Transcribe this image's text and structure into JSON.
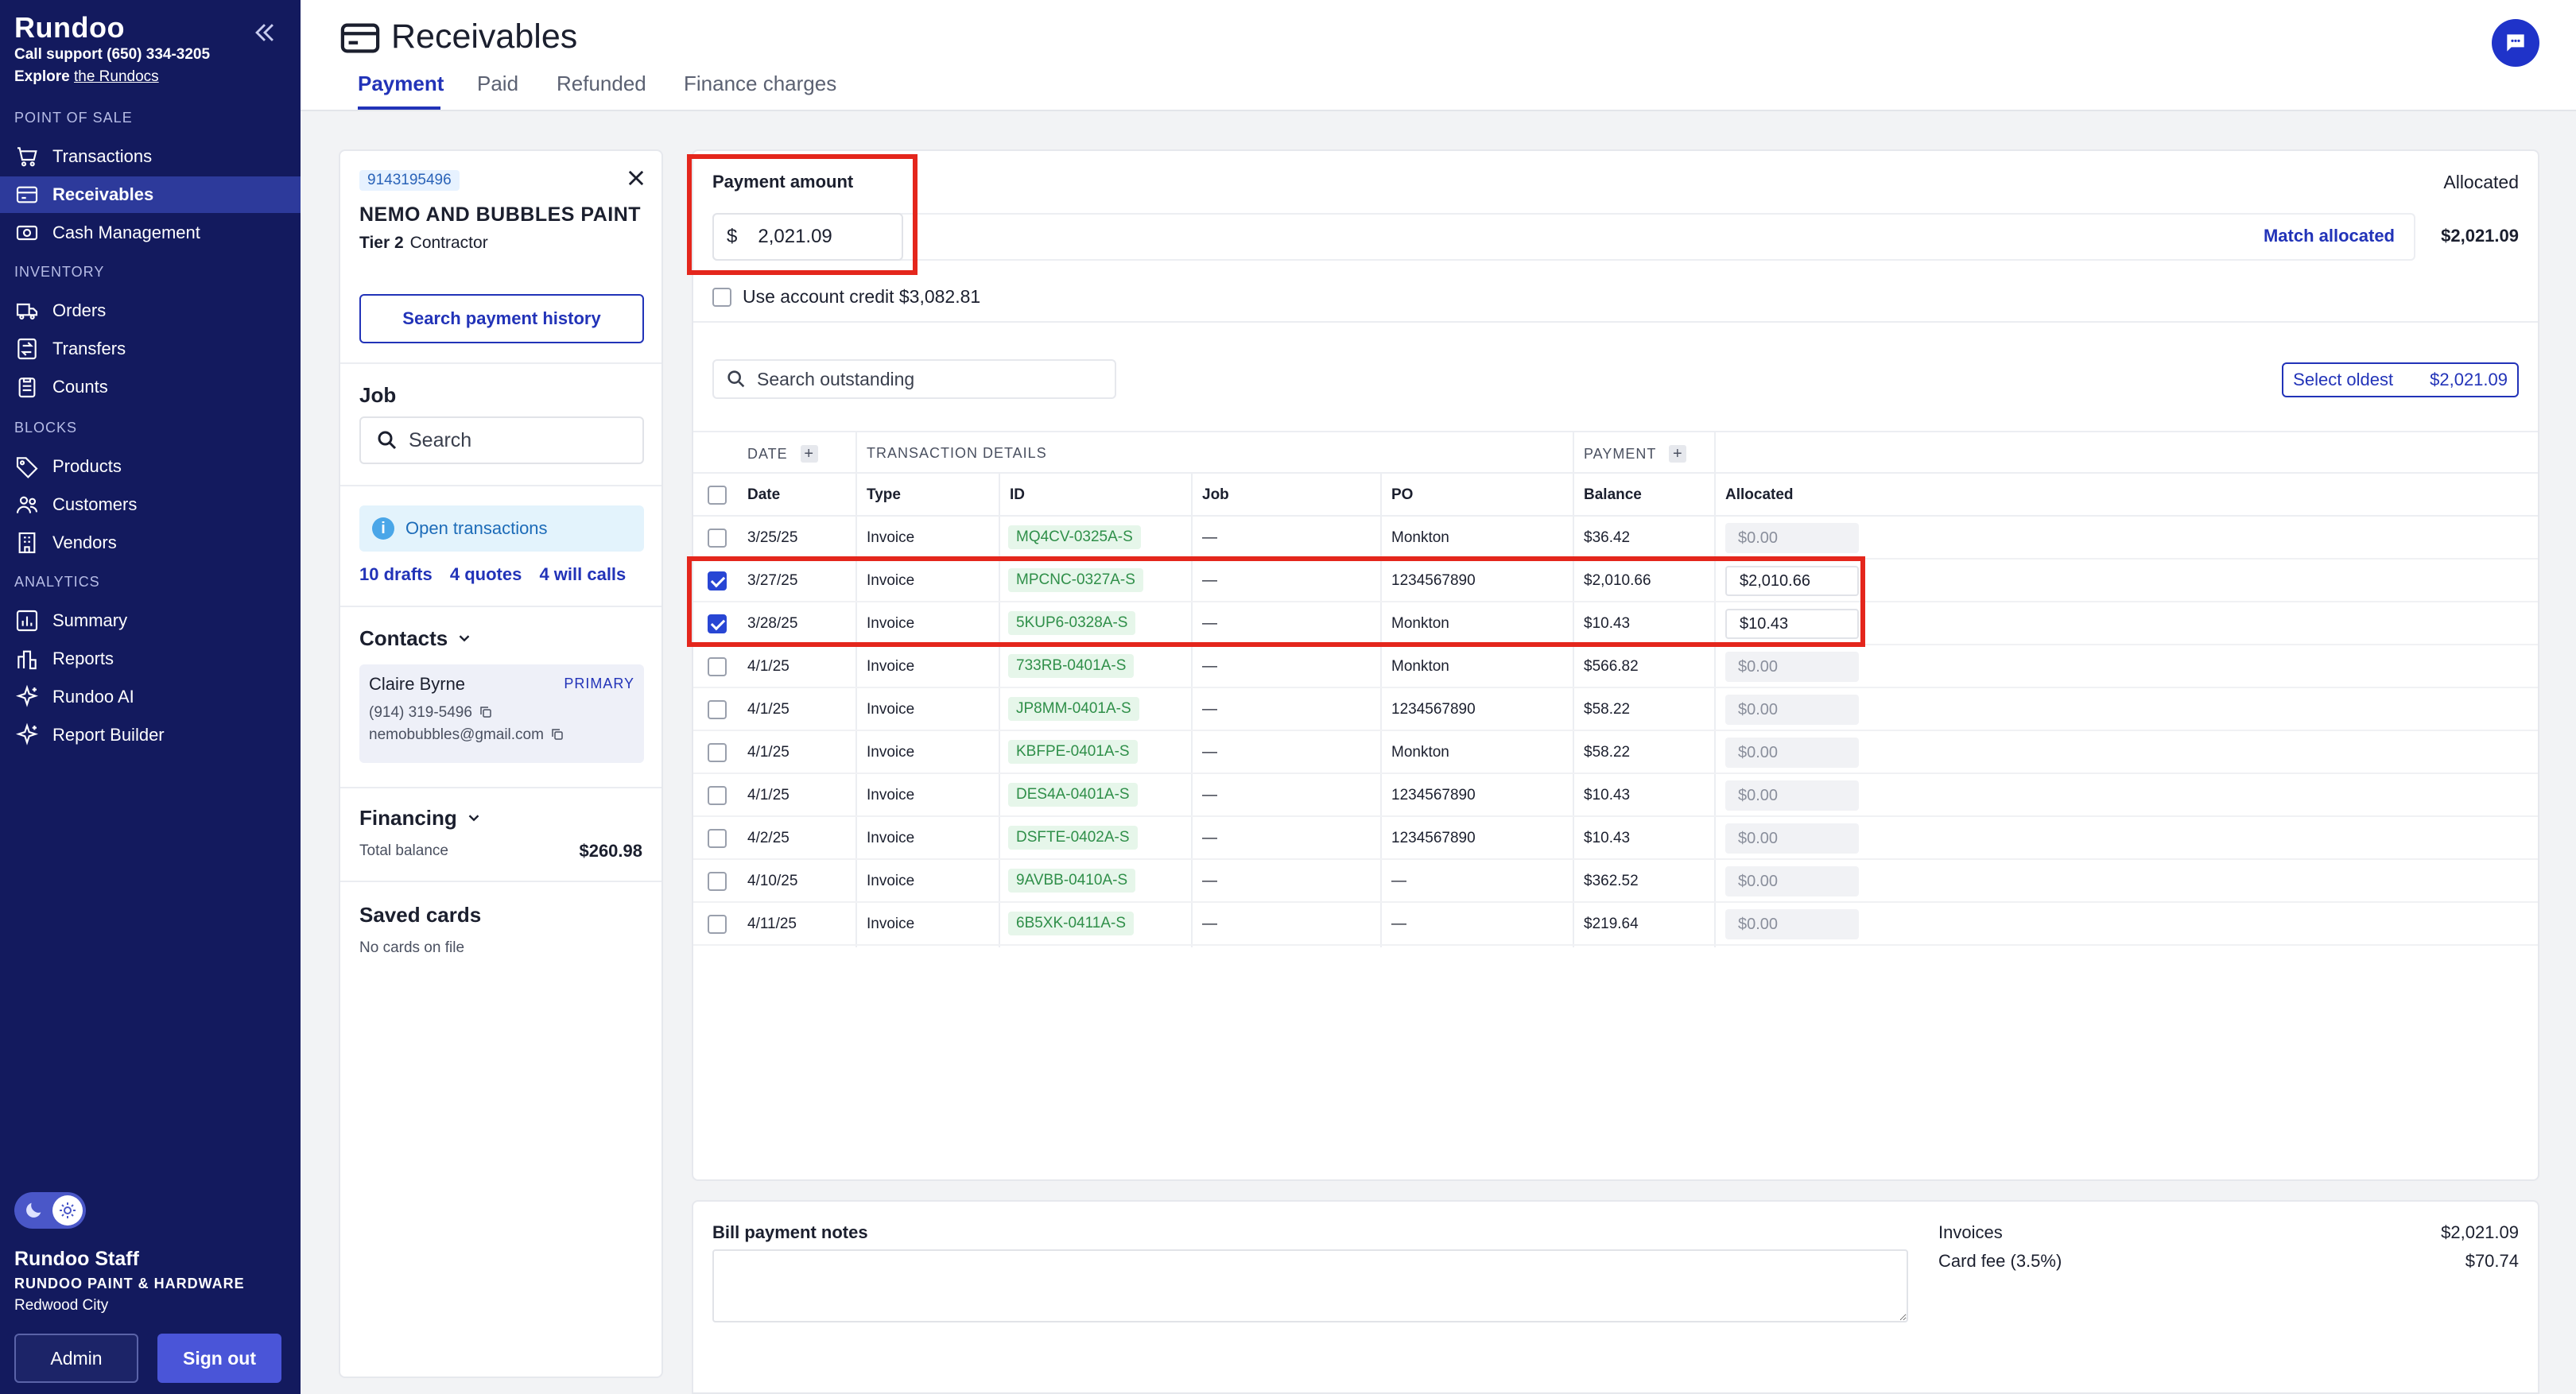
{
  "sidebar": {
    "brand": "Rundoo",
    "support": "Call support (650) 334-3205",
    "explore_prefix": "Explore ",
    "explore_link": "the Rundocs",
    "sections": {
      "pos": "POINT OF SALE",
      "inventory": "INVENTORY",
      "blocks": "BLOCKS",
      "analytics": "ANALYTICS"
    },
    "items": [
      {
        "label": "Transactions",
        "icon": "cart-icon"
      },
      {
        "label": "Receivables",
        "icon": "credit-card-icon",
        "active": true
      },
      {
        "label": "Cash Management",
        "icon": "cash-icon"
      },
      {
        "label": "Orders",
        "icon": "truck-icon"
      },
      {
        "label": "Transfers",
        "icon": "transfer-icon"
      },
      {
        "label": "Counts",
        "icon": "clipboard-icon"
      },
      {
        "label": "Products",
        "icon": "tag-icon"
      },
      {
        "label": "Customers",
        "icon": "people-icon"
      },
      {
        "label": "Vendors",
        "icon": "building-icon"
      },
      {
        "label": "Summary",
        "icon": "bar-chart-icon"
      },
      {
        "label": "Reports",
        "icon": "report-icon"
      },
      {
        "label": "Rundoo AI",
        "icon": "sparkle-icon"
      },
      {
        "label": "Report Builder",
        "icon": "sparkle-icon"
      }
    ],
    "staff_name": "Rundoo Staff",
    "store_name": "RUNDOO PAINT & HARDWARE",
    "city": "Redwood City",
    "admin_label": "Admin",
    "signout_label": "Sign out"
  },
  "header": {
    "title": "Receivables",
    "tabs": [
      {
        "label": "Payment",
        "active": true
      },
      {
        "label": "Paid"
      },
      {
        "label": "Refunded"
      },
      {
        "label": "Finance charges"
      }
    ]
  },
  "customer": {
    "id": "9143195496",
    "name": "NEMO AND BUBBLES PAINT",
    "tier": "Tier 2",
    "type": "Contractor",
    "search_history_label": "Search payment history",
    "job_title": "Job",
    "job_search_placeholder": "Search",
    "open_transactions_label": "Open transactions",
    "links": {
      "drafts": "10 drafts",
      "quotes": "4 quotes",
      "will_calls": "4 will calls"
    },
    "contacts_title": "Contacts",
    "contact": {
      "name": "Claire Byrne",
      "badge": "PRIMARY",
      "phone": "(914) 319-5496",
      "email": "nemobubbles@gmail.com"
    },
    "financing_title": "Financing",
    "total_balance_label": "Total balance",
    "total_balance_value": "$260.98",
    "saved_cards_title": "Saved cards",
    "saved_cards_empty": "No cards on file"
  },
  "payment": {
    "amount_label": "Payment amount",
    "currency_symbol": "$",
    "amount_value": "2,021.09",
    "allocated_label": "Allocated",
    "match_allocated_label": "Match allocated",
    "allocated_total": "$2,021.09",
    "use_credit_label": "Use account credit $3,082.81",
    "search_placeholder": "Search outstanding",
    "select_oldest_label": "Select oldest",
    "select_oldest_amount": "$2,021.09"
  },
  "table": {
    "group_headers": {
      "date": "DATE",
      "details": "TRANSACTION DETAILS",
      "payment": "PAYMENT"
    },
    "columns": [
      "Date",
      "Type",
      "ID",
      "Job",
      "PO",
      "Balance",
      "Allocated"
    ],
    "rows": [
      {
        "date": "3/25/25",
        "type": "Invoice",
        "id": "MQ4CV-0325A-S",
        "job": "—",
        "po": "Monkton",
        "balance": "$36.42",
        "allocated": "$0.00",
        "checked": false
      },
      {
        "date": "3/27/25",
        "type": "Invoice",
        "id": "MPCNC-0327A-S",
        "job": "—",
        "po": "1234567890",
        "balance": "$2,010.66",
        "allocated": "$2,010.66",
        "checked": true
      },
      {
        "date": "3/28/25",
        "type": "Invoice",
        "id": "5KUP6-0328A-S",
        "job": "—",
        "po": "Monkton",
        "balance": "$10.43",
        "allocated": "$10.43",
        "checked": true
      },
      {
        "date": "4/1/25",
        "type": "Invoice",
        "id": "733RB-0401A-S",
        "job": "—",
        "po": "Monkton",
        "balance": "$566.82",
        "allocated": "$0.00",
        "checked": false
      },
      {
        "date": "4/1/25",
        "type": "Invoice",
        "id": "JP8MM-0401A-S",
        "job": "—",
        "po": "1234567890",
        "balance": "$58.22",
        "allocated": "$0.00",
        "checked": false
      },
      {
        "date": "4/1/25",
        "type": "Invoice",
        "id": "KBFPE-0401A-S",
        "job": "—",
        "po": "Monkton",
        "balance": "$58.22",
        "allocated": "$0.00",
        "checked": false
      },
      {
        "date": "4/1/25",
        "type": "Invoice",
        "id": "DES4A-0401A-S",
        "job": "—",
        "po": "1234567890",
        "balance": "$10.43",
        "allocated": "$0.00",
        "checked": false
      },
      {
        "date": "4/2/25",
        "type": "Invoice",
        "id": "DSFTE-0402A-S",
        "job": "—",
        "po": "1234567890",
        "balance": "$10.43",
        "allocated": "$0.00",
        "checked": false
      },
      {
        "date": "4/10/25",
        "type": "Invoice",
        "id": "9AVBB-0410A-S",
        "job": "—",
        "po": "—",
        "balance": "$362.52",
        "allocated": "$0.00",
        "checked": false
      },
      {
        "date": "4/11/25",
        "type": "Invoice",
        "id": "6B5XK-0411A-S",
        "job": "—",
        "po": "—",
        "balance": "$219.64",
        "allocated": "$0.00",
        "checked": false
      }
    ]
  },
  "bottom": {
    "notes_label": "Bill payment notes",
    "invoices_label": "Invoices",
    "invoices_value": "$2,021.09",
    "card_fee_label": "Card fee (3.5%)",
    "card_fee_value": "$70.74"
  },
  "colors": {
    "sidebar_bg": "#131a5e",
    "accent": "#2233b8",
    "highlight_red": "#e4261c",
    "id_chip_green": "#2f8f49"
  }
}
